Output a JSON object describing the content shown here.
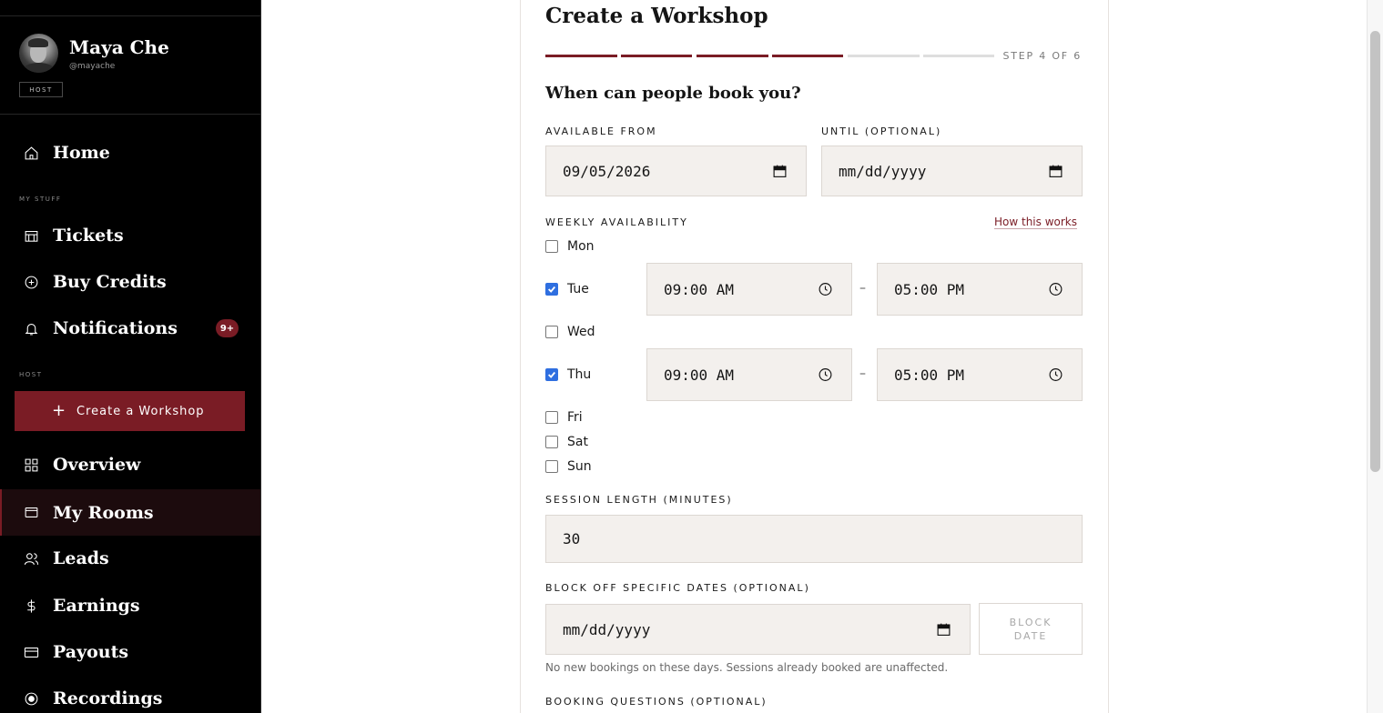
{
  "sidebar": {
    "profile": {
      "name": "Maya Che",
      "handle": "@mayache",
      "badge": "HOST"
    },
    "nav": {
      "home": "Home",
      "section_my_stuff": "MY STUFF",
      "tickets": "Tickets",
      "buy_credits": "Buy Credits",
      "notifications": "Notifications",
      "notifications_badge": "9+",
      "section_host": "HOST",
      "create_workshop": "Create a Workshop",
      "overview": "Overview",
      "my_rooms": "My Rooms",
      "leads": "Leads",
      "earnings": "Earnings",
      "payouts": "Payouts",
      "recordings": "Recordings"
    },
    "active_item": "My Rooms"
  },
  "wizard": {
    "title": "Create a Workshop",
    "step_label": "STEP 4 OF 6",
    "steps_total": 6,
    "steps_completed": 4,
    "question": "When can people book you?",
    "available_from_label": "AVAILABLE FROM",
    "available_from_value": "09/05/2026",
    "until_label": "UNTIL (OPTIONAL)",
    "until_placeholder": "mm/dd/yyyy",
    "weekly_label": "WEEKLY AVAILABILITY",
    "how_link": "How this works",
    "days": [
      {
        "day": "Mon",
        "checked": false
      },
      {
        "day": "Tue",
        "checked": true,
        "start": "09:00 AM",
        "end": "05:00 PM"
      },
      {
        "day": "Wed",
        "checked": false
      },
      {
        "day": "Thu",
        "checked": true,
        "start": "09:00 AM",
        "end": "05:00 PM"
      },
      {
        "day": "Fri",
        "checked": false
      },
      {
        "day": "Sat",
        "checked": false
      },
      {
        "day": "Sun",
        "checked": false
      }
    ],
    "range_separator": "–",
    "session_length_label": "SESSION LENGTH (MINUTES)",
    "session_length_value": "30",
    "block_label": "BLOCK OFF SPECIFIC DATES (OPTIONAL)",
    "block_placeholder": "mm/dd/yyyy",
    "block_button": "BLOCK DATE",
    "block_hint": "No new bookings on these days. Sessions already booked are unaffected.",
    "booking_questions_label": "BOOKING QUESTIONS (OPTIONAL)"
  },
  "colors": {
    "accent": "#7a1c25",
    "sidebar_bg": "#000000",
    "input_bg": "#f3f0ed",
    "step_inactive": "#dedede",
    "checkbox_on": "#2f6fe0"
  }
}
